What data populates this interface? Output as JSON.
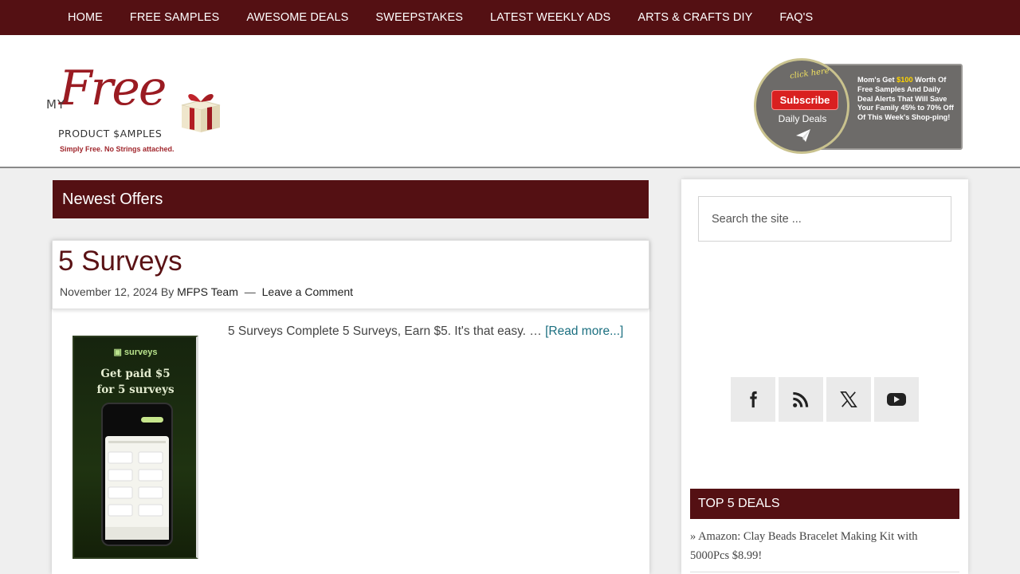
{
  "nav": {
    "items": [
      "HOME",
      "FREE SAMPLES",
      "AWESOME DEALS",
      "SWEEPSTAKES",
      "LATEST WEEKLY ADS",
      "ARTS & CRAFTS DIY",
      "FAQ'S"
    ]
  },
  "logo": {
    "my": "MY",
    "free": "Free",
    "product": "PRODUCT $AMPLES",
    "tagline": "Simply Free. No Strings attached."
  },
  "subscribe_banner": {
    "click_here": "click here",
    "button": "Subscribe",
    "daily_deals": "Daily Deals",
    "pitch_prefix": "Mom's Get ",
    "amount": "$100",
    "pitch_suffix": " Worth Of Free Samples And Daily Deal Alerts That Will Save Your Family  45% to 70% Off Of  This Week's Shop-ping!"
  },
  "main": {
    "section_title": "Newest Offers",
    "post": {
      "title": "5 Surveys",
      "date": "November 12, 2024",
      "by": "By",
      "author": "MFPS Team",
      "separator": "—",
      "comment_link": "Leave a Comment",
      "excerpt": "5 Surveys Complete 5 Surveys, Earn $5. It's that easy. …",
      "read_more": "[Read more...]",
      "thumb_brand": "surveys",
      "thumb_headline_1": "Get paid $5",
      "thumb_headline_2": "for 5 surveys"
    }
  },
  "sidebar": {
    "search_placeholder": "Search the site ...",
    "social_icons": [
      "facebook-icon",
      "rss-icon",
      "x-icon",
      "youtube-icon"
    ],
    "top5_title": "TOP 5 DEALS",
    "deals": [
      "» Amazon: Clay Beads Bracelet Making Kit with 5000Pcs $8.99!"
    ]
  },
  "colors": {
    "brand_maroon": "#541013",
    "link_teal": "#1b6f80",
    "subscribe_red": "#d92020"
  }
}
